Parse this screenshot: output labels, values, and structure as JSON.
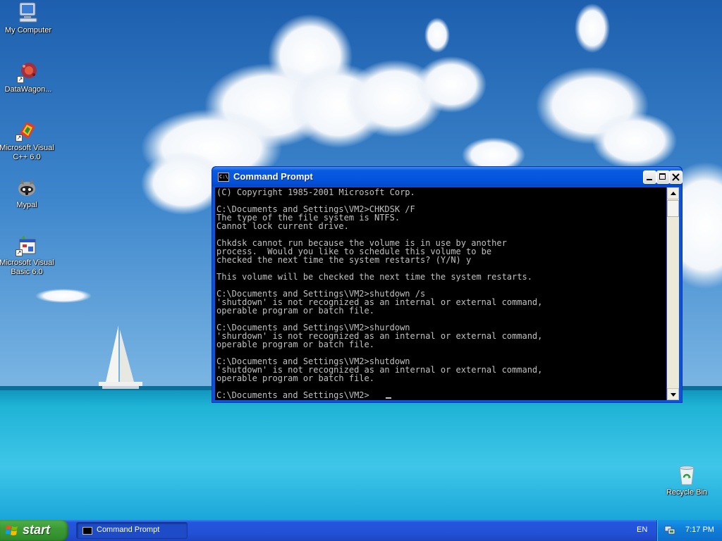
{
  "desktop": {
    "icons": [
      {
        "label": "My Computer",
        "icon": "my-computer-icon"
      },
      {
        "label": "DataWagon...",
        "icon": "datawagon-icon"
      },
      {
        "label": "Microsoft Visual C++ 6.0",
        "icon": "visual-cpp-icon"
      },
      {
        "label": "Mypal",
        "icon": "mypal-icon"
      },
      {
        "label": "Microsoft Visual Basic 6.0",
        "icon": "visual-basic-icon"
      },
      {
        "label": "Recycle Bin",
        "icon": "recycle-bin-icon"
      }
    ]
  },
  "window": {
    "title": "Command Prompt",
    "title_icon_text": "C:\\",
    "lines": [
      "(C) Copyright 1985-2001 Microsoft Corp.",
      "",
      "C:\\Documents and Settings\\VM2>CHKDSK /F",
      "The type of the file system is NTFS.",
      "Cannot lock current drive.",
      "",
      "Chkdsk cannot run because the volume is in use by another",
      "process.  Would you like to schedule this volume to be",
      "checked the next time the system restarts? (Y/N) y",
      "",
      "This volume will be checked the next time the system restarts.",
      "",
      "C:\\Documents and Settings\\VM2>shutdown /s",
      "'shutdown' is not recognized as an internal or external command,",
      "operable program or batch file.",
      "",
      "C:\\Documents and Settings\\VM2>shurdown",
      "'shurdown' is not recognized as an internal or external command,",
      "operable program or batch file.",
      "",
      "C:\\Documents and Settings\\VM2>shutdown",
      "'shutdown' is not recognized as an internal or external command,",
      "operable program or batch file.",
      "",
      "C:\\Documents and Settings\\VM2>"
    ]
  },
  "taskbar": {
    "start_label": "start",
    "tasks": [
      {
        "label": "Command Prompt",
        "icon": "cmd-icon"
      }
    ],
    "language": "EN",
    "clock": "7:17 PM"
  },
  "colors": {
    "console_bg": "#000000",
    "console_fg": "#c0c0c0",
    "titlebar": "#0a5be0",
    "taskbar": "#2352d8",
    "start_green": "#3d9b37"
  }
}
